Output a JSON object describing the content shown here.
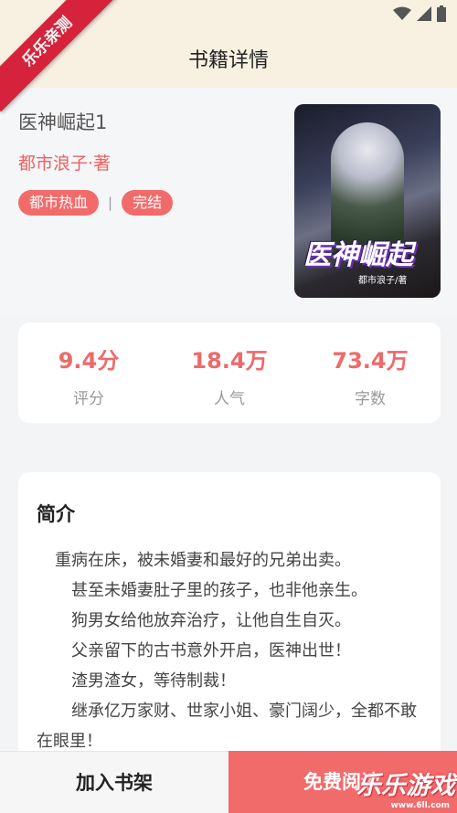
{
  "app": {
    "ribbon_text": "乐乐亲测"
  },
  "nav": {
    "title": "书籍详情"
  },
  "book": {
    "title": "医神崛起1",
    "author": "都市浪子·著",
    "tags": [
      "都市热血",
      "完结"
    ],
    "tag_separator": "|",
    "cover": {
      "title": "医神崛起",
      "subtitle": "都市浪子/著"
    }
  },
  "stats": [
    {
      "value": "9.4分",
      "label": "评分"
    },
    {
      "value": "18.4万",
      "label": "人气"
    },
    {
      "value": "73.4万",
      "label": "字数"
    }
  ],
  "intro": {
    "heading": "简介",
    "paragraphs": [
      "重病在床，被未婚妻和最好的兄弟出卖。",
      "甚至未婚妻肚子里的孩子，也非他亲生。",
      "狗男女给他放弃治疗，让他自生自灭。",
      "父亲留下的古书意外开启，医神出世！",
      "渣男渣女，等待制裁！",
      "继承亿万家财、世家小姐、豪门阔少，全都不敢在眼里！"
    ]
  },
  "actions": {
    "add_shelf": "加入书架",
    "read_free": "免费阅读"
  },
  "watermark": {
    "main": "乐乐游戏",
    "url": "www.6ll.com"
  },
  "colors": {
    "accent": "#f26b6b",
    "header_bg": "#f8f1e2",
    "ribbon": "#d4233a"
  }
}
